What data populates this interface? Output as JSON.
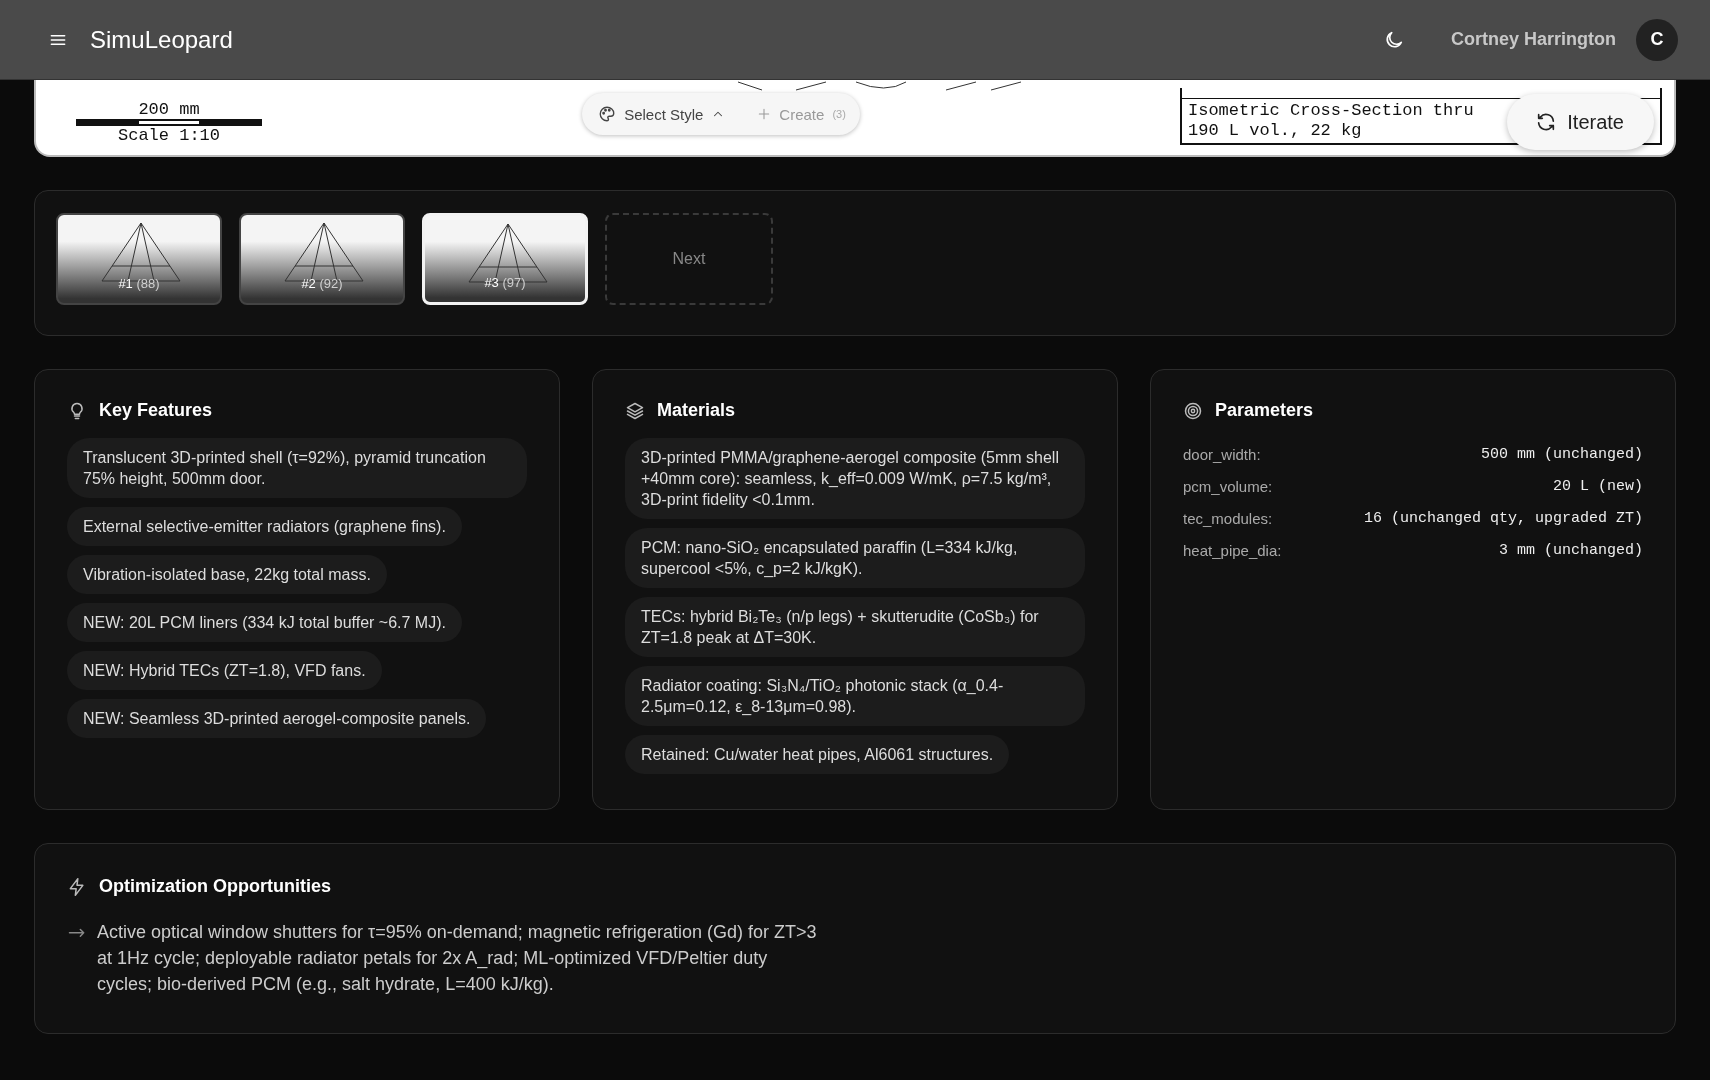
{
  "header": {
    "app_name": "SimuLeopard",
    "user_name": "Cortney Harrington",
    "avatar_initial": "C"
  },
  "drawing": {
    "scale_bar_label": "200 mm",
    "scale": "Scale 1:10",
    "title_block": [
      "Isometric Cross-Section thru",
      "190 L vol., 22 kg"
    ],
    "style_button": "Select Style",
    "create_button": {
      "label": "Create",
      "count": "(3)"
    },
    "iterate_button": "Iterate"
  },
  "iterations": {
    "items": [
      {
        "label": "#1",
        "score": "(88)",
        "selected": false
      },
      {
        "label": "#2",
        "score": "(92)",
        "selected": false
      },
      {
        "label": "#3",
        "score": "(97)",
        "selected": true
      }
    ],
    "next_label": "Next"
  },
  "key_features": {
    "title": "Key Features",
    "items": [
      "Translucent 3D-printed shell (τ=92%), pyramid truncation 75% height, 500mm door.",
      "External selective-emitter radiators (graphene fins).",
      "Vibration-isolated base, 22kg total mass.",
      "NEW: 20L PCM liners (334 kJ total buffer ~6.7 MJ).",
      "NEW: Hybrid TECs (ZT=1.8), VFD fans.",
      "NEW: Seamless 3D-printed aerogel-composite panels."
    ]
  },
  "materials": {
    "title": "Materials",
    "items": [
      "3D-printed PMMA/graphene-aerogel composite (5mm shell +40mm core): seamless, k_eff=0.009 W/mK, ρ=7.5 kg/m³, 3D-print fidelity <0.1mm.",
      "PCM: nano-SiO₂ encapsulated paraffin (L=334 kJ/kg, supercool <5%, c_p=2 kJ/kgK).",
      "TECs: hybrid Bi₂Te₃ (n/p legs) + skutterudite (CoSb₃) for ZT=1.8 peak at ΔT=30K.",
      "Radiator coating: Si₃N₄/TiO₂ photonic stack (α_0.4-2.5μm=0.12, ε_8-13μm=0.98).",
      "Retained: Cu/water heat pipes, Al6061 structures."
    ]
  },
  "parameters": {
    "title": "Parameters",
    "rows": [
      {
        "name": "door_width:",
        "value": "500 mm (unchanged)"
      },
      {
        "name": "pcm_volume:",
        "value": "20 L (new)"
      },
      {
        "name": "tec_modules:",
        "value": "16 (unchanged qty, upgraded ZT)"
      },
      {
        "name": "heat_pipe_dia:",
        "value": "3 mm (unchanged)"
      }
    ]
  },
  "optimization": {
    "title": "Optimization Opportunities",
    "items": [
      "Active optical window shutters for τ=95% on-demand; magnetic refrigeration (Gd) for ZT>3 at 1Hz cycle; deployable radiator petals for 2x A_rad; ML-optimized VFD/Peltier duty cycles; bio-derived PCM (e.g., salt hydrate, L=400 kJ/kg)."
    ]
  }
}
